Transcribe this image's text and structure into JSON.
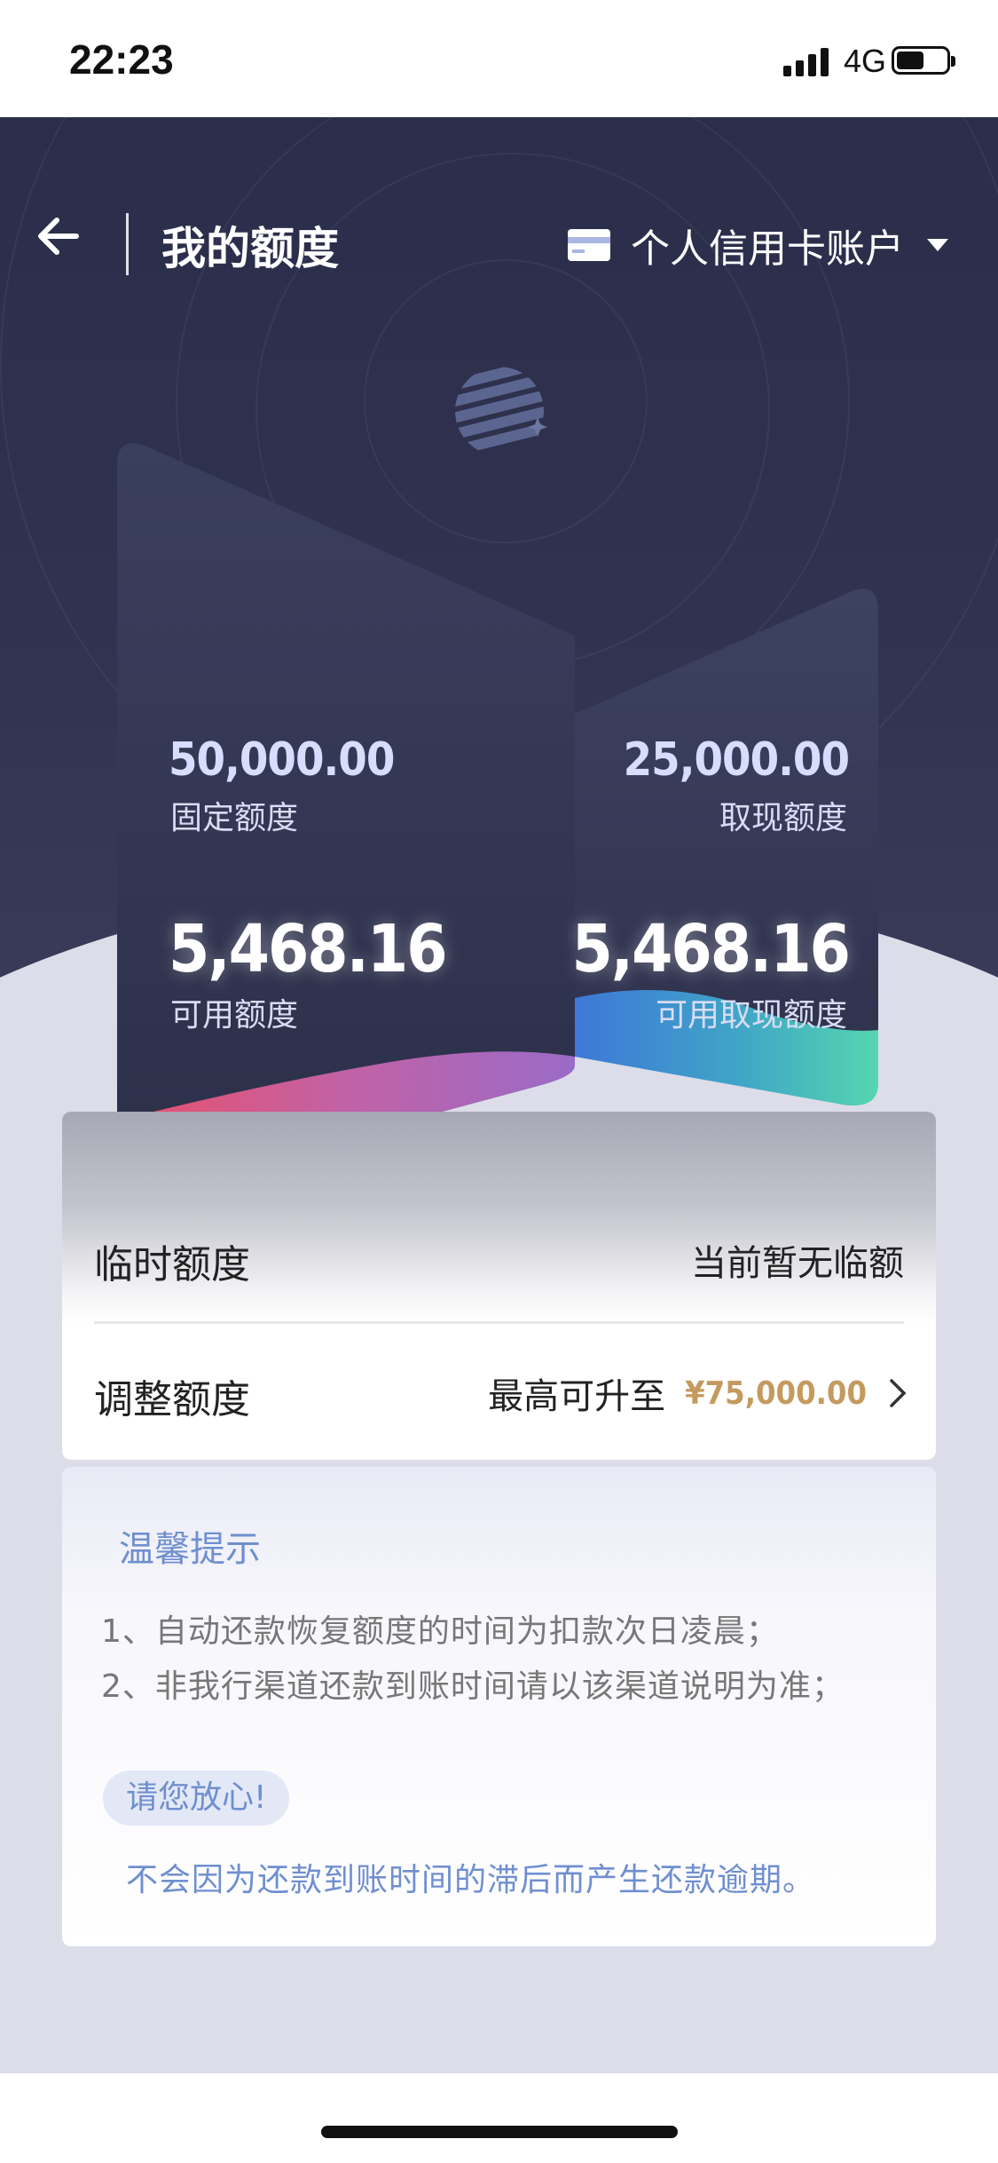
{
  "status_bar": {
    "time": "22:23",
    "network": "4G",
    "battery_level": 0.55
  },
  "nav": {
    "title": "我的额度",
    "account_label": "个人信用卡账户"
  },
  "left_card": {
    "fixed_amount": "50,000.00",
    "fixed_label": "固定额度",
    "available_amount": "5,468.16",
    "available_label": "可用额度"
  },
  "right_card": {
    "cash_amount": "25,000.00",
    "cash_label": "取现额度",
    "available_cash_amount": "5,468.16",
    "available_cash_label": "可用取现额度"
  },
  "temp_limit": {
    "title": "临时额度",
    "value": "当前暂无临额"
  },
  "adjust_limit": {
    "title": "调整额度",
    "prefix": "最高可升至",
    "amount": "¥75,000.00"
  },
  "tips": {
    "title": "温馨提示",
    "lines": [
      "1、自动还款恢复额度的时间为扣款次日凌晨；",
      "2、非我行渠道还款到账时间请以该渠道说明为准；"
    ],
    "badge": "请您放心!",
    "reassure": "不会因为还款到账时间的滞后而产生还款逾期。"
  },
  "colors": {
    "hero_bg": "#2b2e4a",
    "accent_gold": "#c49a5f",
    "tips_blue": "#6f8fcf"
  }
}
